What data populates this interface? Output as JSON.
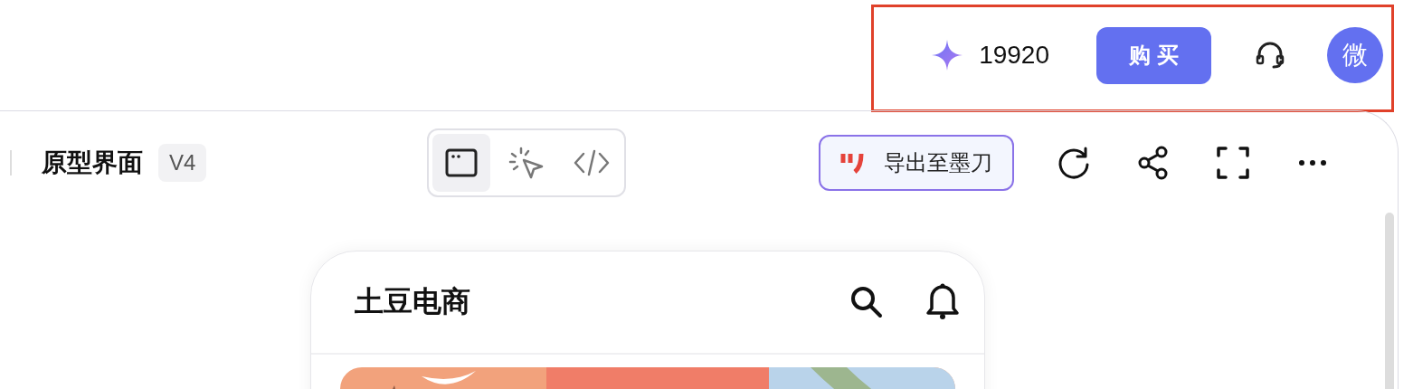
{
  "top_bar": {
    "credits": "19920",
    "buy_button": "购 买",
    "avatar": "微"
  },
  "toolbar": {
    "title": "原型界面",
    "version": "V4",
    "view_modes": [
      {
        "kind": "preview",
        "selected": true
      },
      {
        "kind": "inspect",
        "selected": false
      },
      {
        "kind": "code",
        "selected": false
      }
    ],
    "export_button": "导出至墨刀"
  },
  "phone": {
    "app_title": "土豆电商"
  }
}
